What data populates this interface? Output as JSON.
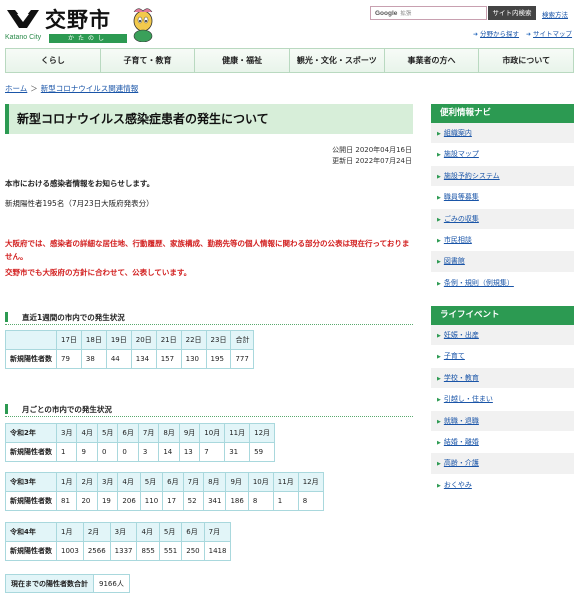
{
  "header": {
    "logo_text": "交野市",
    "logo_en": "Katano City",
    "logo_kana": "かたのし",
    "search_engine": "Google",
    "search_placeholder": "拡張",
    "search_button": "サイト内検索",
    "search_help": "検索方法",
    "link_category": "分野から探す",
    "link_sitemap": "サイトマップ"
  },
  "nav": [
    "くらし",
    "子育て・教育",
    "健康・福祉",
    "観光・文化・スポーツ",
    "事業者の方へ",
    "市政について"
  ],
  "breadcrumb": {
    "home": "ホーム",
    "sep": "＞",
    "current": "新型コロナウイルス関連情報"
  },
  "page": {
    "title": "新型コロナウイルス感染症患者の発生について",
    "published": "公開日 2020年04月16日",
    "updated": "更新日 2022年07月24日",
    "intro": "本市における感染者情報をお知らせします。",
    "count": "新規陽性者195名（7月23日大阪府発表分）",
    "warning": "大阪府では、感染者の詳細な居住地、行動履歴、家族構成、勤務先等の個人情報に関わる部分の公表は現在行っておりません。",
    "warning2": "交野市でも大阪府の方針に合わせて、公表しています。"
  },
  "weekly": {
    "heading": "直近1週間の市内での発生状況",
    "days": [
      "17日",
      "18日",
      "19日",
      "20日",
      "21日",
      "22日",
      "23日",
      "合計"
    ],
    "row_label": "新規陽性者数",
    "values": [
      "79",
      "38",
      "44",
      "134",
      "157",
      "130",
      "195",
      "777"
    ]
  },
  "monthly": {
    "heading": "月ごとの市内での発生状況",
    "row_label": "新規陽性者数",
    "years": [
      {
        "label": "令和2年",
        "months": [
          "3月",
          "4月",
          "5月",
          "6月",
          "7月",
          "8月",
          "9月",
          "10月",
          "11月",
          "12月"
        ],
        "values": [
          "1",
          "9",
          "0",
          "0",
          "3",
          "14",
          "13",
          "7",
          "31",
          "59"
        ]
      },
      {
        "label": "令和3年",
        "months": [
          "1月",
          "2月",
          "3月",
          "4月",
          "5月",
          "6月",
          "7月",
          "8月",
          "9月",
          "10月",
          "11月",
          "12月"
        ],
        "values": [
          "81",
          "20",
          "19",
          "206",
          "110",
          "17",
          "52",
          "341",
          "186",
          "8",
          "1",
          "8"
        ]
      },
      {
        "label": "令和4年",
        "months": [
          "1月",
          "2月",
          "3月",
          "4月",
          "5月",
          "6月",
          "7月"
        ],
        "values": [
          "1003",
          "2566",
          "1337",
          "855",
          "551",
          "250",
          "1418"
        ]
      }
    ]
  },
  "total": {
    "label": "現在までの陽性者数合計",
    "value": "9166人"
  },
  "sidebar": {
    "nav_title": "便利情報ナビ",
    "nav_items": [
      "組織案内",
      "施設マップ",
      "施設予約システム",
      "職員等募集",
      "ごみの収集",
      "市民相談",
      "図書館",
      "条例・規則（例規集）"
    ],
    "life_title": "ライフイベント",
    "life_items": [
      "妊娠・出産",
      "子育て",
      "学校・教育",
      "引越し・住まい",
      "就職・退職",
      "結婚・離婚",
      "高齢・介護",
      "おくやみ"
    ]
  },
  "colors": {
    "brand_green": "#2c9a52",
    "title_bg": "#d7eed9",
    "warning_red": "#d21f1f",
    "table_head": "#e2f5f8"
  }
}
